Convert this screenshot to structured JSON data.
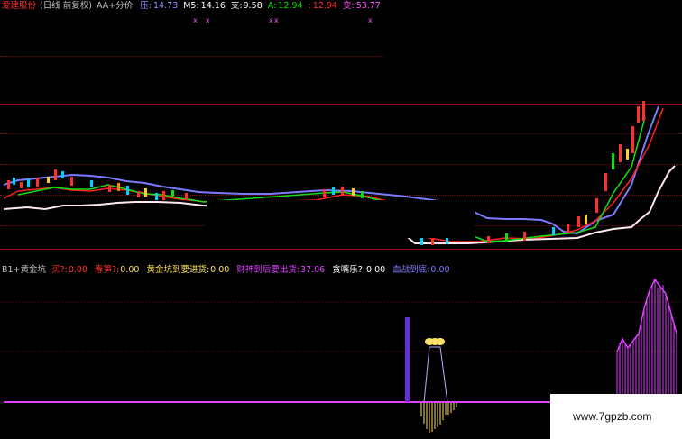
{
  "top_header": {
    "stock_name": "爱建股份",
    "period": "(日线 前复权)",
    "indicator": "AA+分价",
    "ya_label": "压:",
    "ya_value": "14.73",
    "m5_label": "M5:",
    "m5_value": "14.16",
    "zhi_label": "支:",
    "zhi_value": "9.58",
    "a_label": "A:",
    "a_value": "12.94",
    "blank_label": ":",
    "blank_value": "12.94",
    "bian_label": "变:",
    "bian_value": "53.77"
  },
  "bottom_header": {
    "indicator": "B1+黄金坑",
    "mai_label": "买?:",
    "mai_value": "0.00",
    "chunsun_label": "春笋?:",
    "chunsun_value": "0.00",
    "hjk_label": "黄金坑到要进货:",
    "hjk_value": "0.00",
    "caishen_label": "财神到后要出货:",
    "caishen_value": "37.06",
    "tanle_label": "贪嘴乐?:",
    "tanle_value": "0.00",
    "qiangshi_label": "血战到底:",
    "qiangshi_value": "0.00"
  },
  "watermark": {
    "text": "www.7gpzb.com"
  },
  "markers": [
    "x",
    "x",
    "x",
    "x",
    "x"
  ],
  "colors": {
    "background": "#000000",
    "grid": "#7a1010",
    "ya": "#7b7bff",
    "m5": "#ffffff",
    "zhi": "#ffffff",
    "a": "#00ff00",
    "blank": "#ff2a2a",
    "bian": "#ff55ff",
    "purple_bar": "#6a2bd9",
    "magenta": "#e040ff",
    "yellow": "#ffe060"
  }
}
